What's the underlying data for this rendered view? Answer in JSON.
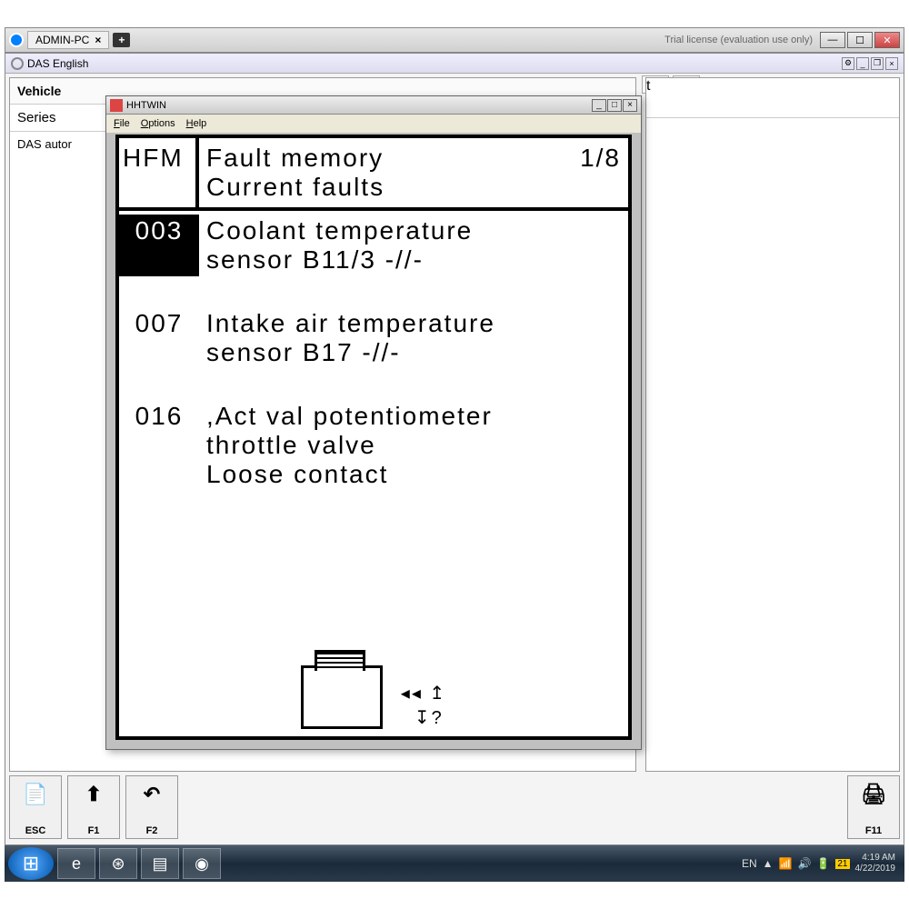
{
  "titlebar": {
    "tab_name": "ADMIN-PC",
    "trial_text": "Trial license (evaluation use only)"
  },
  "app": {
    "title": "DAS English",
    "vehicle_label": "Vehicle",
    "series_label": "Series",
    "body_text": "DAS autor",
    "right_header": "t"
  },
  "hht": {
    "title": "HHTWIN",
    "menu": {
      "file": "File",
      "options": "Options",
      "help": "Help"
    },
    "hfm": "HFM",
    "header_line1": "Fault memory",
    "page": "1/8",
    "header_line2": "Current faults",
    "faults": [
      {
        "code": "003",
        "selected": true,
        "text": "Coolant temperature\nsensor B11/3 -//-"
      },
      {
        "code": "007",
        "selected": false,
        "text": "Intake air temperature\nsensor B17 -//-"
      },
      {
        "code": "016",
        "selected": false,
        "text": ",Act val potentiometer\nthrottle valve\nLoose contact"
      }
    ]
  },
  "footer": {
    "esc": "ESC",
    "f1": "F1",
    "f2": "F2",
    "f11": "F11"
  },
  "taskbar": {
    "lang": "EN",
    "time": "4:19 AM",
    "date": "4/22/2019"
  }
}
